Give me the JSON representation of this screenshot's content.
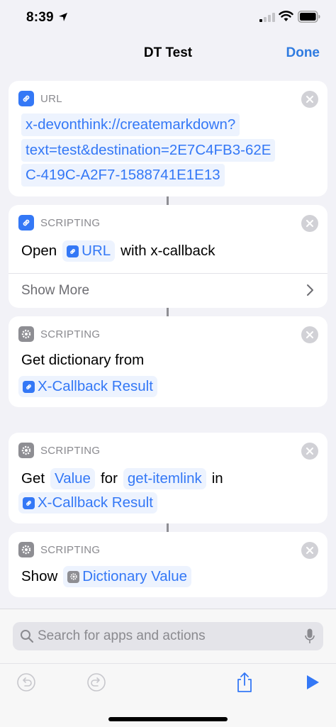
{
  "status_bar": {
    "time": "8:39"
  },
  "nav": {
    "title": "DT Test",
    "done_label": "Done"
  },
  "actions": [
    {
      "category": "URL",
      "url_lines": [
        "x-devonthink://createmarkdown?",
        "text=test&destination=2E7C4FB3-62E",
        "C-419C-A2F7-1588741E1E13"
      ]
    },
    {
      "category": "SCRIPTING",
      "text_open": "Open",
      "token_url": "URL",
      "text_with": "with x-callback",
      "show_more_label": "Show More"
    },
    {
      "category": "SCRIPTING",
      "text_get_dict": "Get dictionary from",
      "token_result": "X-Callback Result"
    },
    {
      "category": "SCRIPTING",
      "text_get": "Get",
      "token_value": "Value",
      "text_for": "for",
      "token_key": "get-itemlink",
      "text_in": "in",
      "token_result": "X-Callback Result"
    },
    {
      "category": "SCRIPTING",
      "text_show": "Show",
      "token_dict_value": "Dictionary Value"
    }
  ],
  "search": {
    "placeholder": "Search for apps and actions"
  },
  "icons": {
    "link": "link-icon",
    "gear": "gear-icon",
    "close": "close-icon",
    "undo": "undo-icon",
    "redo": "redo-icon",
    "share": "share-icon",
    "play": "play-icon"
  },
  "colors": {
    "accent": "#3478f6",
    "done": "#2f7be0",
    "scripting_gray": "#8e8e93"
  }
}
